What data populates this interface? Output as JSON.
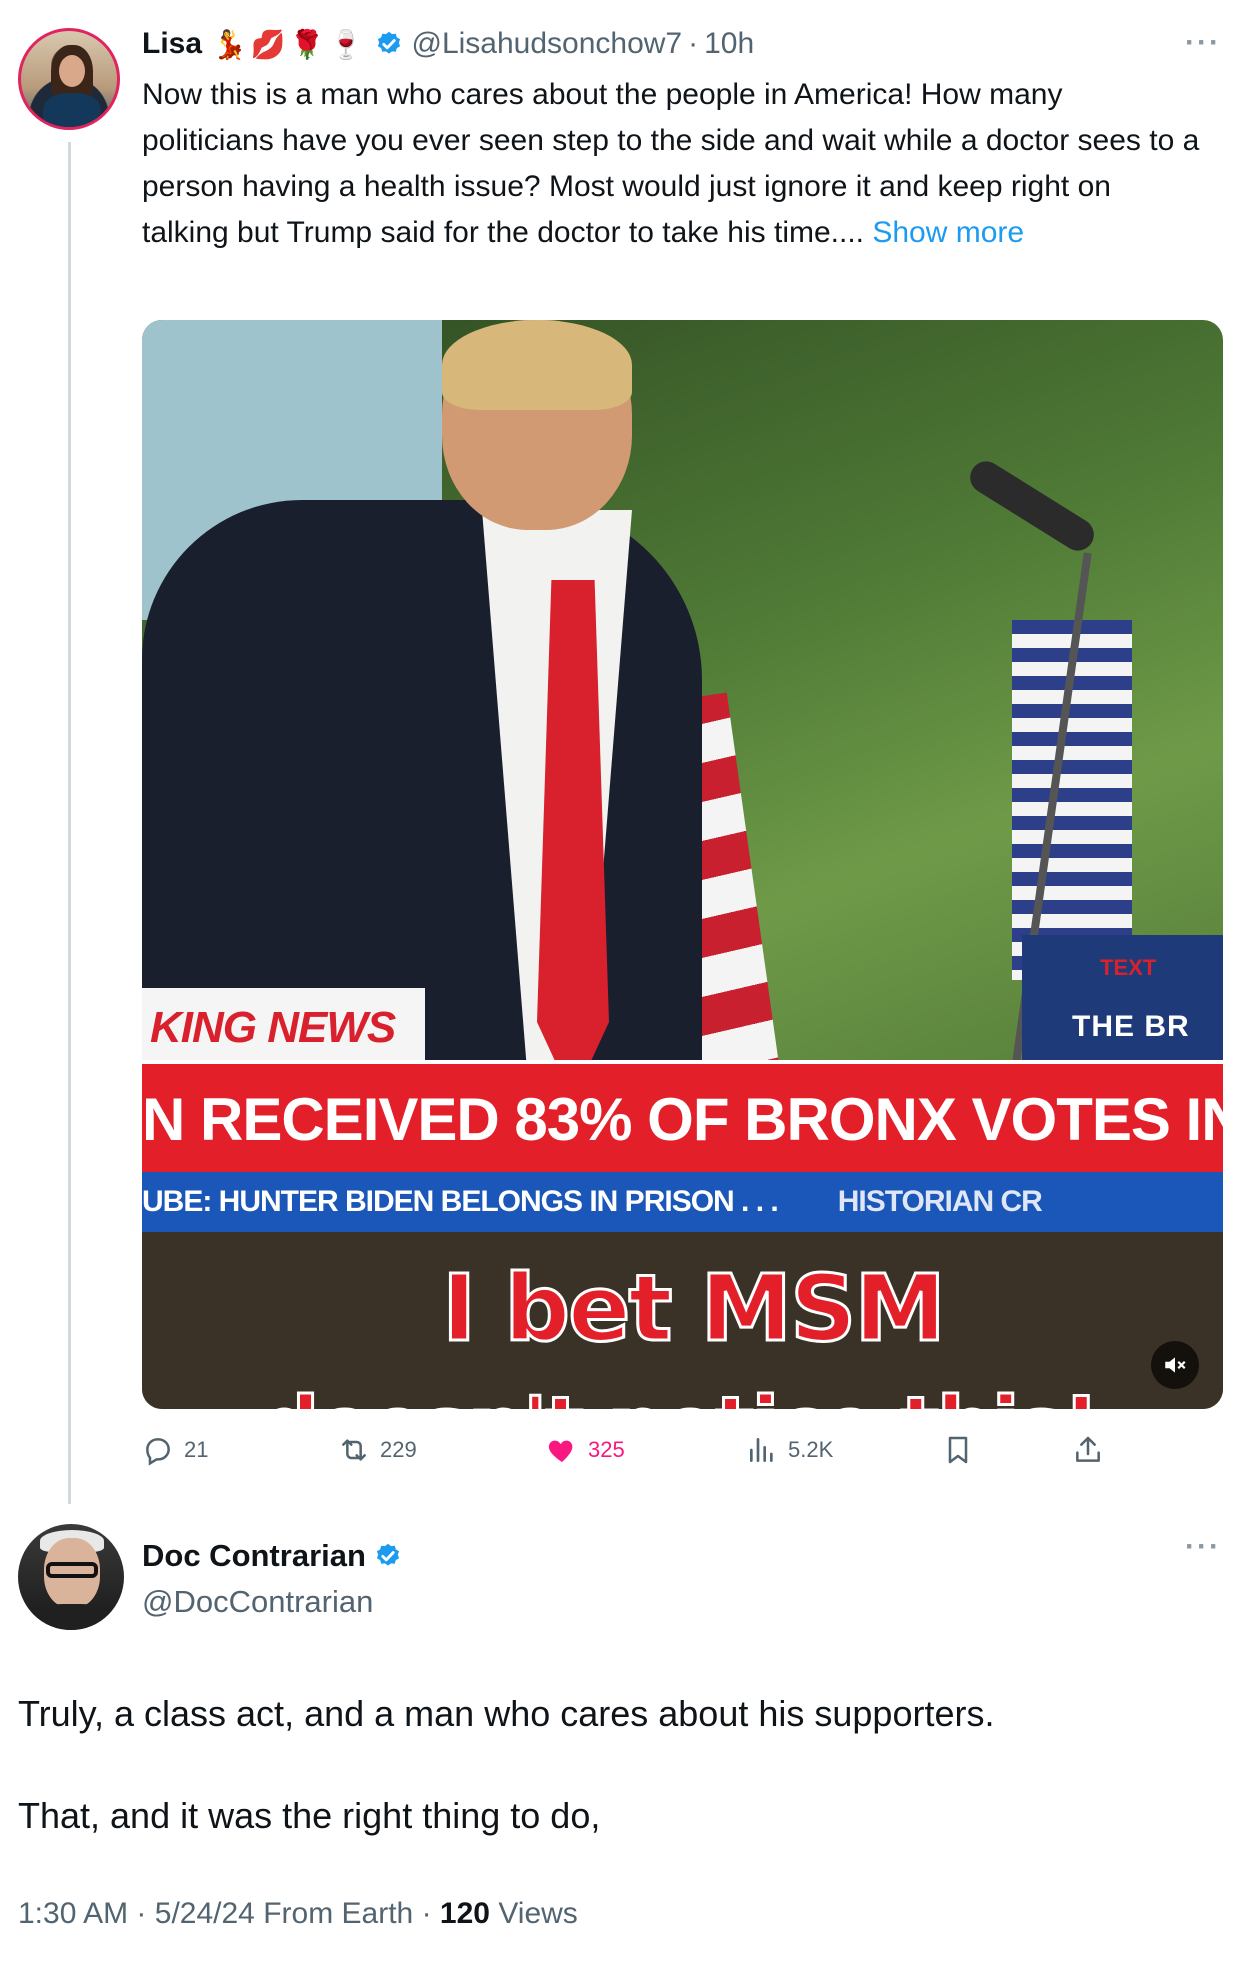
{
  "parent_tweet": {
    "author_name": "Lisa",
    "author_emojis": "💃💋🌹🍷",
    "handle": "@Lisahudsonchow7",
    "separator": "·",
    "time": "10h",
    "more": "···",
    "text": "Now this is a man who cares about the people in America! How many politicians have you ever seen step to the side and wait while a doctor sees to a person having a health issue? Most would just ignore it and keep right on talking but Trump said for the doctor to take his time....",
    "show_more": "Show more",
    "video": {
      "breaking_label": "KING NEWS",
      "headline": "N RECEIVED 83% OF BRONX VOTES IN",
      "ticker_left": "UBE: HUNTER BIDEN BELONGS IN PRISON . . .",
      "ticker_right": "HISTORIAN CR",
      "podium_line1": "TEXT",
      "podium_line2": "THE BR",
      "caption_line1": "I bet MSM",
      "caption_line2": "doesn't notice this!",
      "mute_icon": "speaker-muted-icon"
    },
    "actions": {
      "replies": "21",
      "reposts": "229",
      "likes": "325",
      "views": "5.2K"
    },
    "colors": {
      "link": "#1d9bf0",
      "like": "#f91880",
      "verified": "#1d9bf0"
    }
  },
  "reply_tweet": {
    "author_name": "Doc Contrarian",
    "handle": "@DocContrarian",
    "more": "···",
    "paragraph1": "Truly, a class act, and a man who cares about his supporters.",
    "paragraph2": "That, and it was the right thing to do,",
    "meta": {
      "time": "1:30 AM",
      "sep1": "·",
      "date": "5/24/24",
      "source": "From Earth",
      "sep2": "·",
      "views_count": "120",
      "views_label": "Views"
    }
  }
}
